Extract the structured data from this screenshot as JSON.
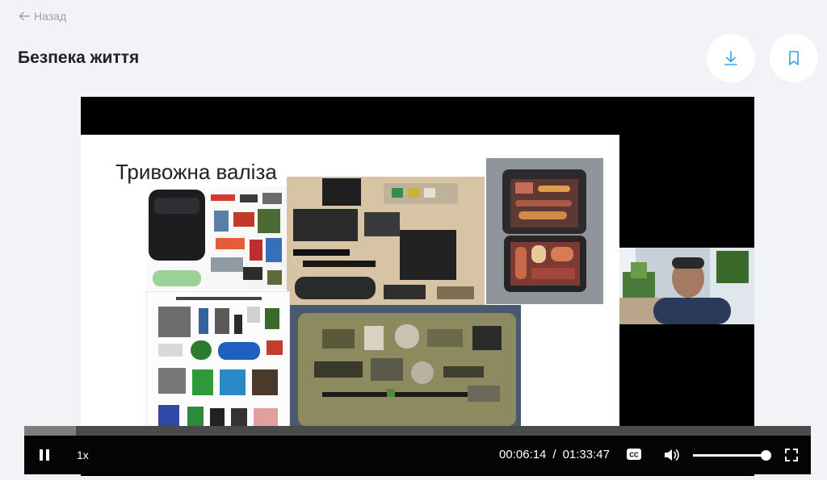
{
  "nav": {
    "back_label": "Назад",
    "back_icon": "arrow-left-icon"
  },
  "page": {
    "title": "Безпека життя"
  },
  "actions": {
    "download_icon": "download-icon",
    "bookmark_icon": "bookmark-icon",
    "accent_color": "#3aa0e8"
  },
  "slide": {
    "title": "Тривожна валіза"
  },
  "player": {
    "speed": "1x",
    "current_time": "00:06:14",
    "separator": "/",
    "duration": "01:33:47",
    "progress_fraction": 0.066,
    "volume_fraction": 1.0,
    "state": "playing"
  }
}
